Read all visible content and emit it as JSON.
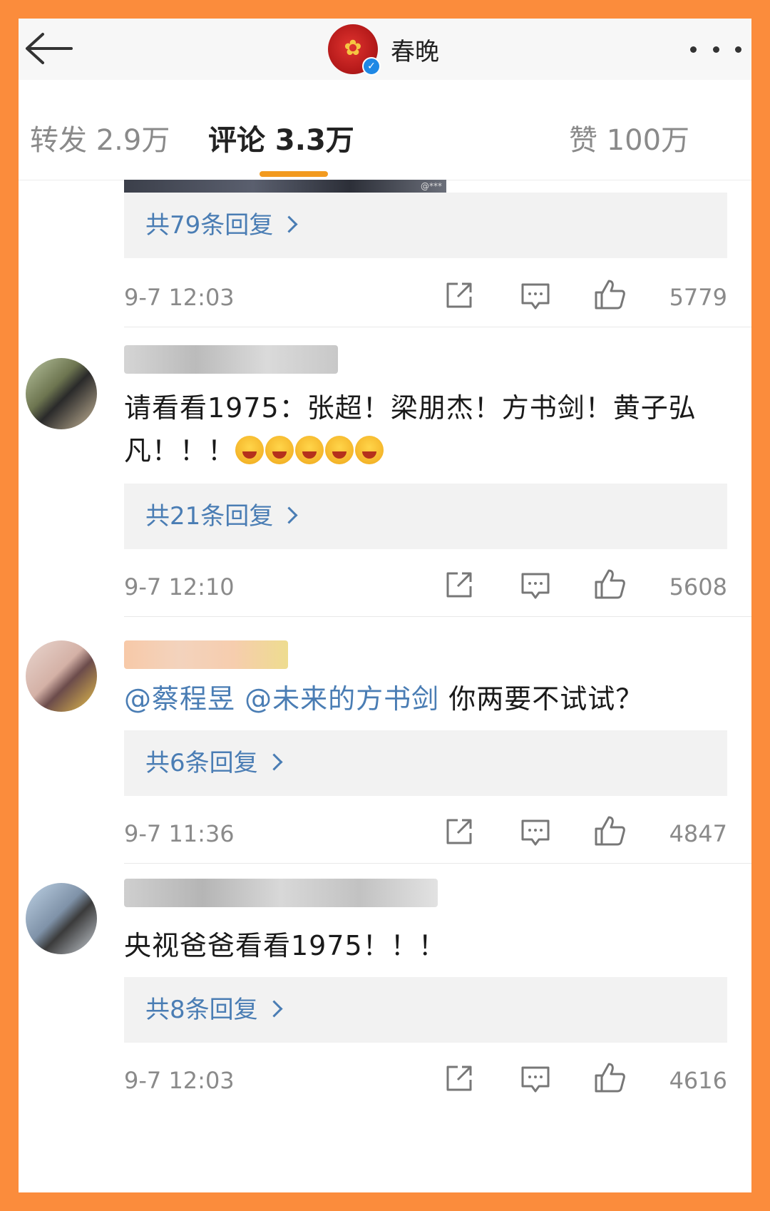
{
  "header": {
    "account_name": "春晚"
  },
  "tabs": [
    {
      "label": "转发 2.9万"
    },
    {
      "label": "评论 3.3万"
    },
    {
      "label": "赞 100万"
    }
  ],
  "comments": [
    {
      "replies_label": "共79条回复",
      "time": "9-7 12:03",
      "likes": "5779"
    },
    {
      "text": "请看看1975：张超！梁朋杰！方书剑！黄子弘凡！！！",
      "replies_label": "共21条回复",
      "time": "9-7 12:10",
      "likes": "5608"
    },
    {
      "mention1": "@蔡程昱",
      "mention2": "@未来的方书剑",
      "text": "你两要不试试？",
      "replies_label": "共6条回复",
      "time": "9-7 11:36",
      "likes": "4847"
    },
    {
      "text": "央视爸爸看看1975！！！",
      "replies_label": "共8条回复",
      "time": "9-7 12:03",
      "likes": "4616"
    }
  ],
  "icons": {
    "back": "arrow-left-icon",
    "more": "more-dots-icon",
    "share": "share-icon",
    "comment": "comment-icon",
    "like": "thumbs-up-icon"
  },
  "colors": {
    "frame": "#fb8c3c",
    "tab_underline": "#f29a1f",
    "link": "#4a7db4"
  }
}
